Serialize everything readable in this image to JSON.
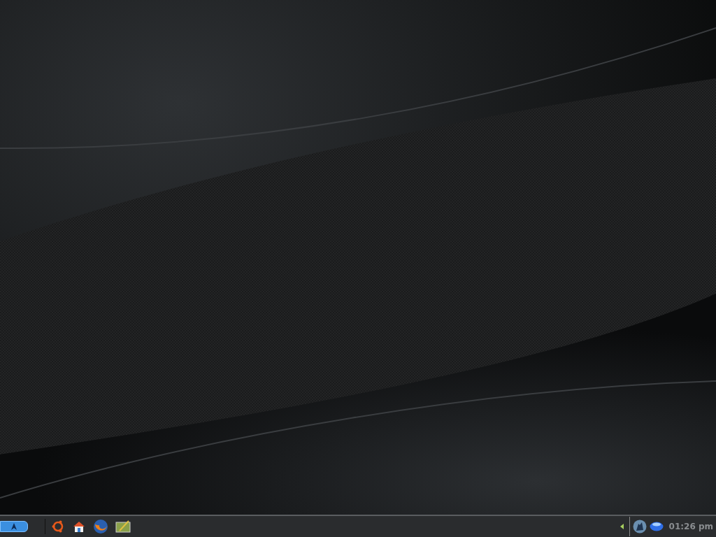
{
  "taskbar": {
    "clock": "01:26 pm"
  }
}
